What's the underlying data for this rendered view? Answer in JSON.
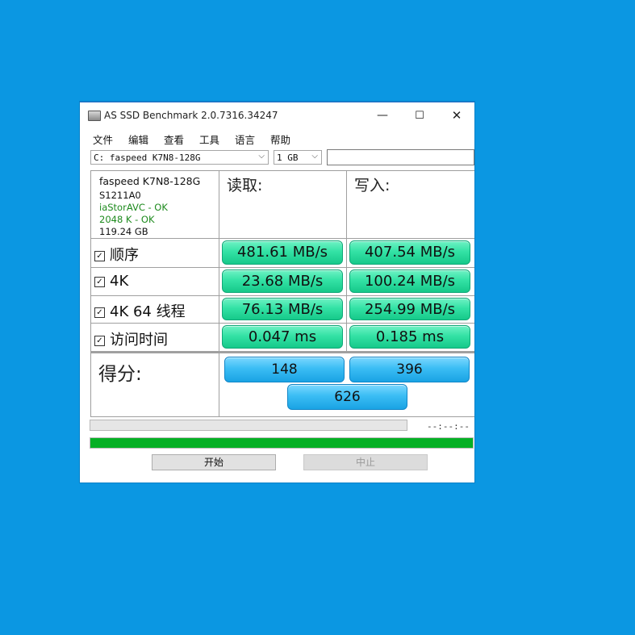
{
  "window": {
    "title": "AS SSD Benchmark 2.0.7316.34247",
    "controls": {
      "minimize": "—",
      "maximize": "☐",
      "close": "✕"
    }
  },
  "menu": [
    "文件",
    "编辑",
    "查看",
    "工具",
    "语言",
    "帮助"
  ],
  "drive_select": {
    "value": "C: faspeed K7N8-128G"
  },
  "size_select": {
    "value": "1 GB"
  },
  "drive_info": {
    "model": "faspeed K7N8-128G",
    "firmware": "S1211A0",
    "driver_status": "iaStorAVC - OK",
    "alignment_status": "2048 K - OK",
    "capacity": "119.24 GB"
  },
  "headers": {
    "read": "读取:",
    "write": "写入:"
  },
  "tests": [
    {
      "label": "顺序",
      "checked": true,
      "read": "481.61 MB/s",
      "write": "407.54 MB/s"
    },
    {
      "label": "4K",
      "checked": true,
      "read": "23.68 MB/s",
      "write": "100.24 MB/s"
    },
    {
      "label": "4K 64 线程",
      "checked": true,
      "read": "76.13 MB/s",
      "write": "254.99 MB/s"
    },
    {
      "label": "访问时间",
      "checked": true,
      "read": "0.047 ms",
      "write": "0.185 ms"
    }
  ],
  "score": {
    "label": "得分:",
    "read": "148",
    "write": "396",
    "total": "626"
  },
  "progress": {
    "value": 0,
    "time": "--:--:--"
  },
  "status_bar": {
    "value": 1.0
  },
  "buttons": {
    "start": "开始",
    "abort": "中止"
  },
  "colors": {
    "desktop": "#0b97e2",
    "result_green": "#34e2a5",
    "score_blue": "#3bbdf4",
    "progress_green": "#06b025",
    "ok_text": "#1d8a1d"
  }
}
